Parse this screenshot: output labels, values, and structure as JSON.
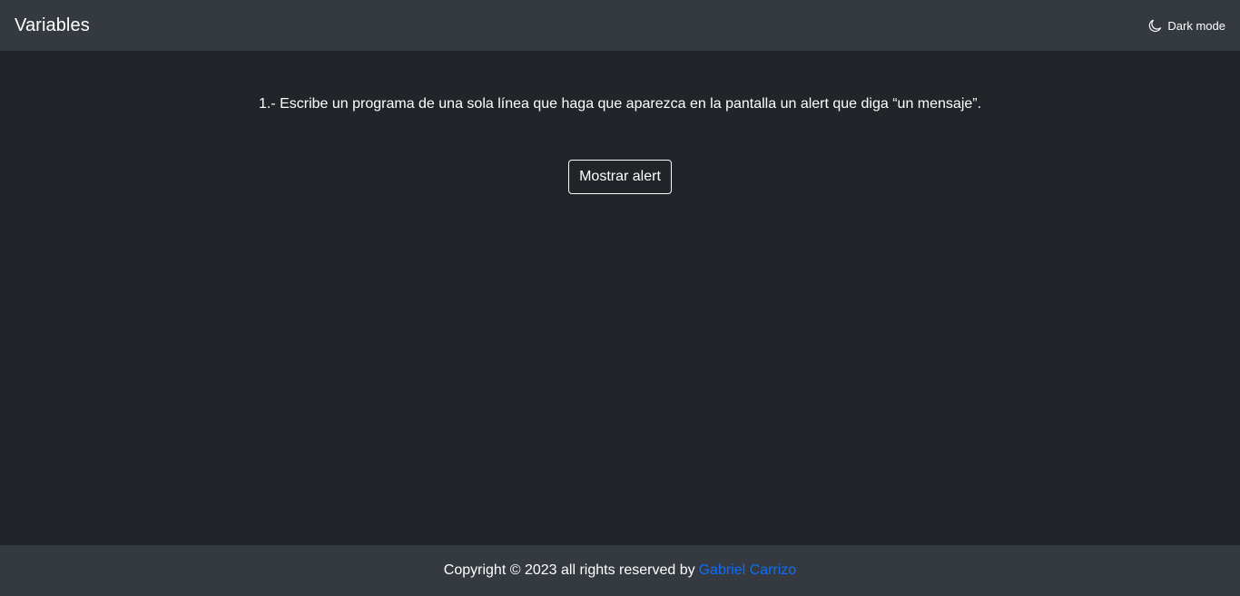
{
  "navbar": {
    "brand": "Variables",
    "theme_toggle_label": "Dark mode",
    "theme_icon": "moon-icon"
  },
  "main": {
    "exercise_text": "1.- Escribe un programa de una sola línea que haga que aparezca en la pantalla un alert que diga “un mensaje”.",
    "button_label": "Mostrar alert"
  },
  "footer": {
    "copyright_text": "Copyright © 2023 all rights reserved by",
    "author_link": "Gabriel Carrizo"
  },
  "colors": {
    "background": "#212529",
    "bars": "#343a40",
    "link": "#0d6efd",
    "text": "#ffffff"
  }
}
